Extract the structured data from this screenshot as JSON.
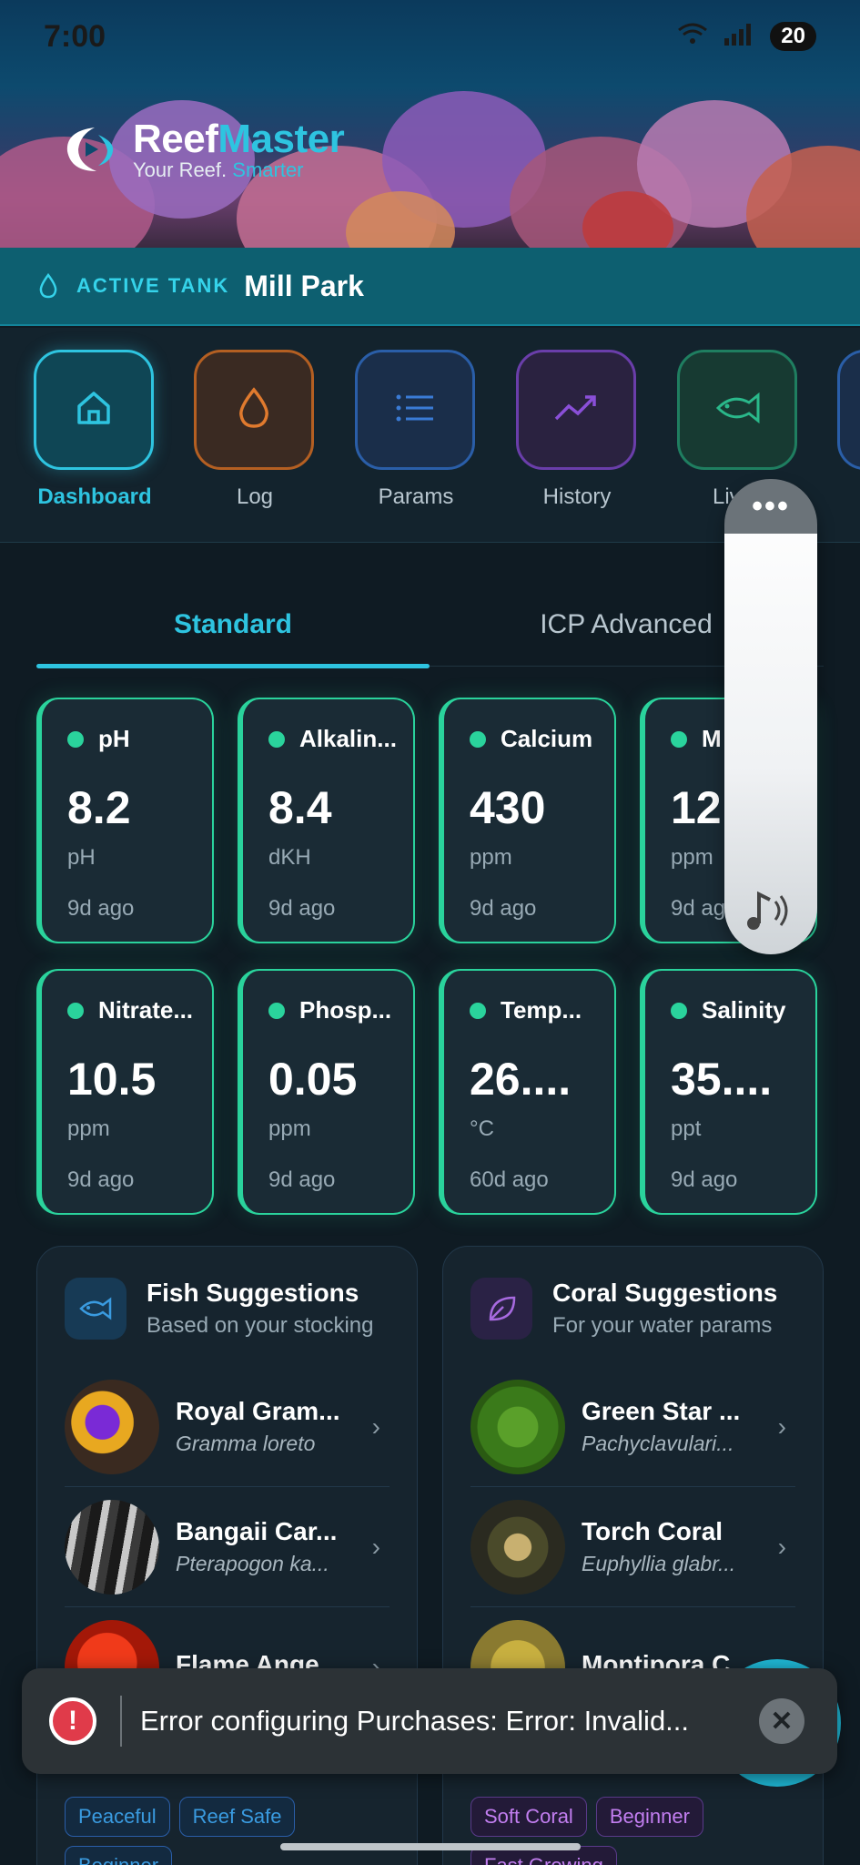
{
  "status": {
    "time": "7:00",
    "battery": "20"
  },
  "brand": {
    "name_a": "Reef",
    "name_b": "Master",
    "tagline_a": "Your Reef. ",
    "tagline_b": "Smarter"
  },
  "tank": {
    "label": "ACTIVE TANK",
    "name": "Mill Park"
  },
  "nav": {
    "items": [
      {
        "label": "Dashboard",
        "icon": "home-icon",
        "color": "#2ec4e0"
      },
      {
        "label": "Log",
        "icon": "drop-icon",
        "color": "#e07a2e"
      },
      {
        "label": "Params",
        "icon": "list-icon",
        "color": "#3a7bd5"
      },
      {
        "label": "History",
        "icon": "trend-icon",
        "color": "#8a4fd8"
      },
      {
        "label": "Lives",
        "icon": "fish-icon",
        "color": "#2ab88a"
      }
    ]
  },
  "tabs": {
    "standard": "Standard",
    "icp": "ICP Advanced"
  },
  "params": [
    {
      "name": "pH",
      "value": "8.2",
      "unit": "pH",
      "ago": "9d ago"
    },
    {
      "name": "Alkalin...",
      "value": "8.4",
      "unit": "dKH",
      "ago": "9d ago"
    },
    {
      "name": "Calcium",
      "value": "430",
      "unit": "ppm",
      "ago": "9d ago"
    },
    {
      "name": "M",
      "value": "12",
      "unit": "ppm",
      "ago": "9d ag"
    },
    {
      "name": "Nitrate...",
      "value": "10.5",
      "unit": "ppm",
      "ago": "9d ago"
    },
    {
      "name": "Phosp...",
      "value": "0.05",
      "unit": "ppm",
      "ago": "9d ago"
    },
    {
      "name": "Temp...",
      "value": "26....",
      "unit": "°C",
      "ago": "60d ago"
    },
    {
      "name": "Salinity",
      "value": "35....",
      "unit": "ppt",
      "ago": "9d ago"
    }
  ],
  "fish": {
    "title": "Fish Suggestions",
    "subtitle": "Based on your stocking",
    "items": [
      {
        "name": "Royal Gram...",
        "sci": "Gramma loreto"
      },
      {
        "name": "Bangaii Car...",
        "sci": "Pterapogon ka..."
      },
      {
        "name": "Flame Ange...",
        "sci": ""
      }
    ],
    "chips": [
      "Peaceful",
      "Reef Safe",
      "Beginner"
    ]
  },
  "coral": {
    "title": "Coral Suggestions",
    "subtitle": "For your water params",
    "items": [
      {
        "name": "Green Star ...",
        "sci": "Pachyclavulari..."
      },
      {
        "name": "Torch Coral",
        "sci": "Euphyllia glabr..."
      },
      {
        "name": "Montipora C...",
        "sci": ""
      }
    ],
    "chips": [
      "Soft Coral",
      "Beginner",
      "Fast Growing"
    ]
  },
  "snackbar": {
    "message": "Error configuring Purchases: Error: Invalid..."
  },
  "colors": {
    "accent": "#2ec4e0",
    "ok": "#2ad39c",
    "error": "#e03b4a"
  }
}
